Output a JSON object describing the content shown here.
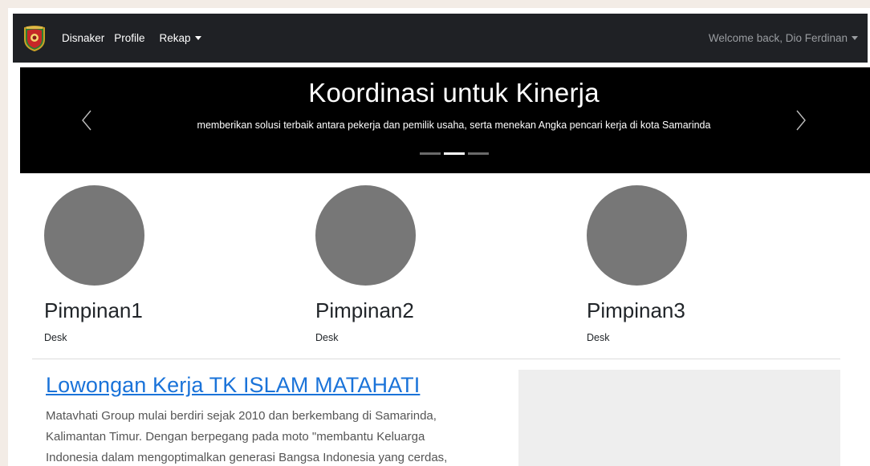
{
  "navbar": {
    "logo_icon": "emblem-icon",
    "links": [
      "Disnaker",
      "Profile",
      "Rekap"
    ],
    "welcome": "Welcome back, Dio Ferdinan"
  },
  "carousel": {
    "title": "Koordinasi untuk Kinerja",
    "caption": "memberikan solusi terbaik antara pekerja dan pemilik usaha, serta menekan Angka pencari kerja di kota Samarinda",
    "active_slide": 2,
    "slide_count": 3
  },
  "leaders": [
    {
      "name": "Pimpinan1",
      "desc": "Desk"
    },
    {
      "name": "Pimpinan2",
      "desc": "Desk"
    },
    {
      "name": "Pimpinan3",
      "desc": "Desk"
    }
  ],
  "job": {
    "title": "Lowongan Kerja TK ISLAM MATAHATI",
    "body_lines": [
      "Matavhati Group mulai berdiri sejak 2010 dan berkembang di Samarinda,",
      "Kalimantan Timur. Dengan berpegang pada moto \"membantu Keluarga",
      "Indonesia dalam mengoptimalkan generasi Bangsa Indonesia yang cerdas,"
    ]
  },
  "colors": {
    "navbar_bg": "#1f2125",
    "carousel_bg": "#000000",
    "link": "#1a73d9",
    "avatar": "#777777"
  }
}
